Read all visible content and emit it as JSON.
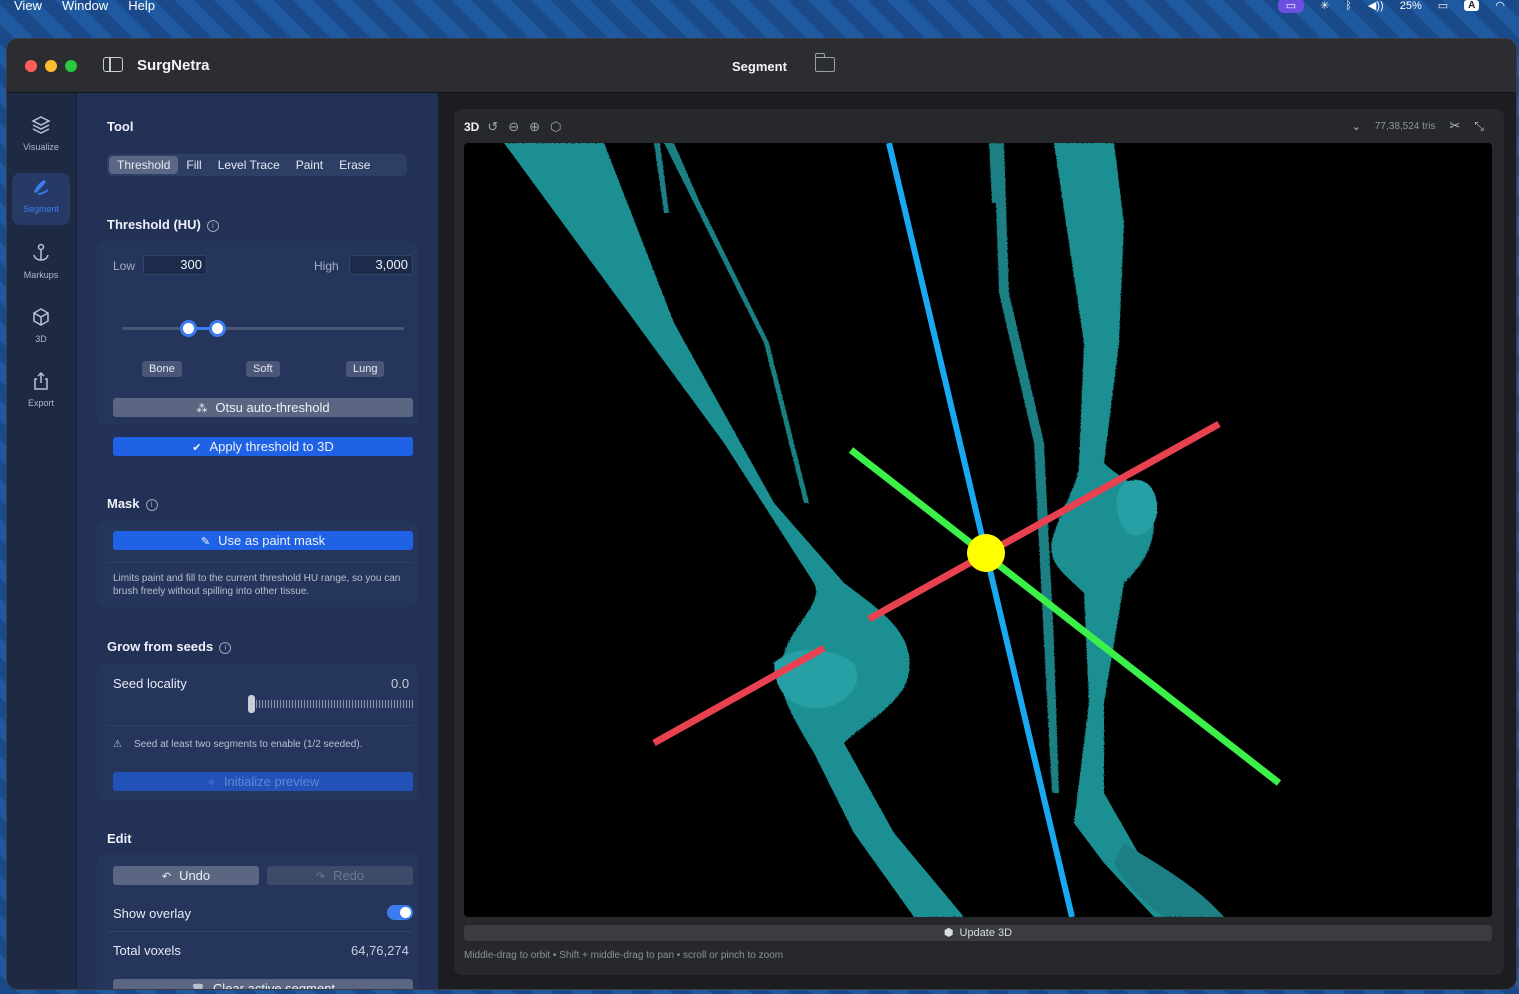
{
  "menubar": {
    "items": [
      "View",
      "Window",
      "Help"
    ],
    "battery": "25%",
    "input_source": "A"
  },
  "titlebar": {
    "app_name": "SurgNetra",
    "center_title": "Segment"
  },
  "rail": {
    "items": [
      {
        "label": "Visualize",
        "icon": "layers-icon"
      },
      {
        "label": "Segment",
        "icon": "brush-icon",
        "active": true
      },
      {
        "label": "Markups",
        "icon": "anchor-icon"
      },
      {
        "label": "3D",
        "icon": "cube-icon"
      },
      {
        "label": "Export",
        "icon": "share-icon"
      }
    ]
  },
  "tool": {
    "title": "Tool",
    "modes": [
      "Threshold",
      "Fill",
      "Level Trace",
      "Paint",
      "Erase"
    ],
    "active_mode": "Threshold"
  },
  "threshold": {
    "title": "Threshold (HU)",
    "low_label": "Low",
    "low_value": "300",
    "high_label": "High",
    "high_value": "3,000",
    "presets": [
      "Bone",
      "Soft",
      "Lung"
    ],
    "otsu_button": "Otsu auto-threshold",
    "apply_button": "Apply threshold to 3D"
  },
  "mask": {
    "title": "Mask",
    "button": "Use as paint mask",
    "note": "Limits paint and fill to the current threshold HU range, so you can brush freely without spilling into other tissue."
  },
  "grow": {
    "title": "Grow from seeds",
    "seed_label": "Seed locality",
    "seed_value": "0.0",
    "warning": "Seed at least two segments to enable (1/2 seeded).",
    "init_button": "Initialize preview"
  },
  "edit": {
    "title": "Edit",
    "undo": "Undo",
    "redo": "Redo",
    "show_overlay_label": "Show overlay",
    "show_overlay": true,
    "total_voxels_label": "Total voxels",
    "total_voxels": "64,76,274",
    "clear_button": "Clear active segment"
  },
  "viewport": {
    "mode_label": "3D",
    "tris": "77,38,524 tris",
    "update_button": "Update 3D",
    "hint": "Middle-drag to orbit • Shift + middle-drag to pan • scroll or pinch to zoom"
  },
  "colors": {
    "accent": "#3d7cf0",
    "bone": "#1f8f93",
    "axis_red": "#e8414f",
    "axis_green": "#3cf04a",
    "axis_blue": "#1aa8f0",
    "pivot": "#ffff00"
  }
}
